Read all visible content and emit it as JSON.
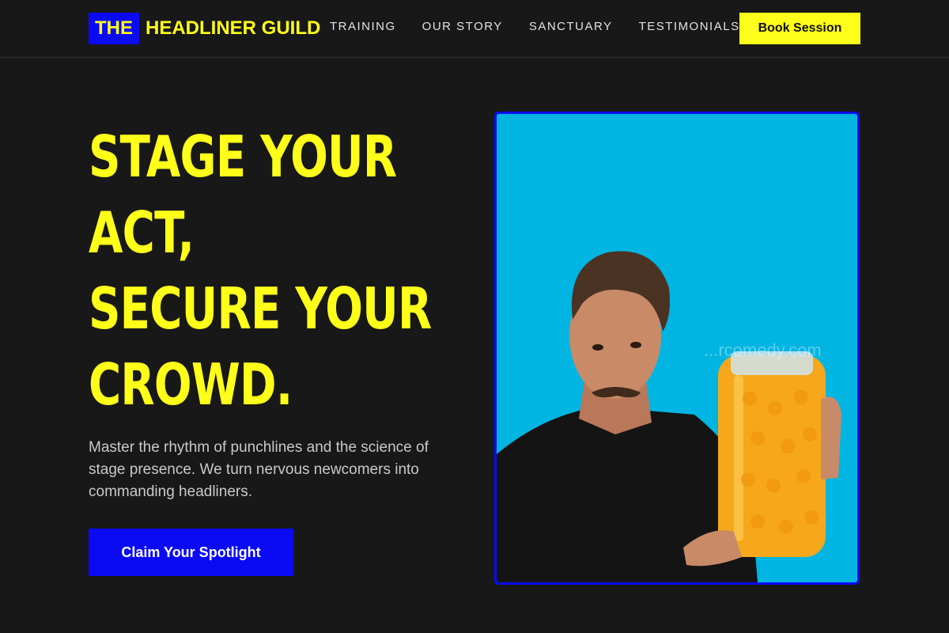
{
  "header": {
    "logo_box": "THE",
    "logo_text": "HEADLINER GUILD",
    "nav": [
      "TRAINING",
      "OUR STORY",
      "SANCTUARY",
      "TESTIMONIALS"
    ],
    "book_label": "Book Session"
  },
  "hero": {
    "headline": [
      "STAGE YOUR",
      "ACT,",
      "SECURE YOUR",
      "CROWD."
    ],
    "subtext": "Master the rhythm of punchlines and the science of stage presence. We turn nervous newcomers into commanding headliners.",
    "cta_label": "Claim Your Spotlight",
    "image_watermark": "...rcomedy.com"
  },
  "colors": {
    "background": "#181818",
    "accent_yellow": "#ffff1a",
    "accent_blue": "#0a0af5",
    "photo_bg": "#00b5e2"
  }
}
